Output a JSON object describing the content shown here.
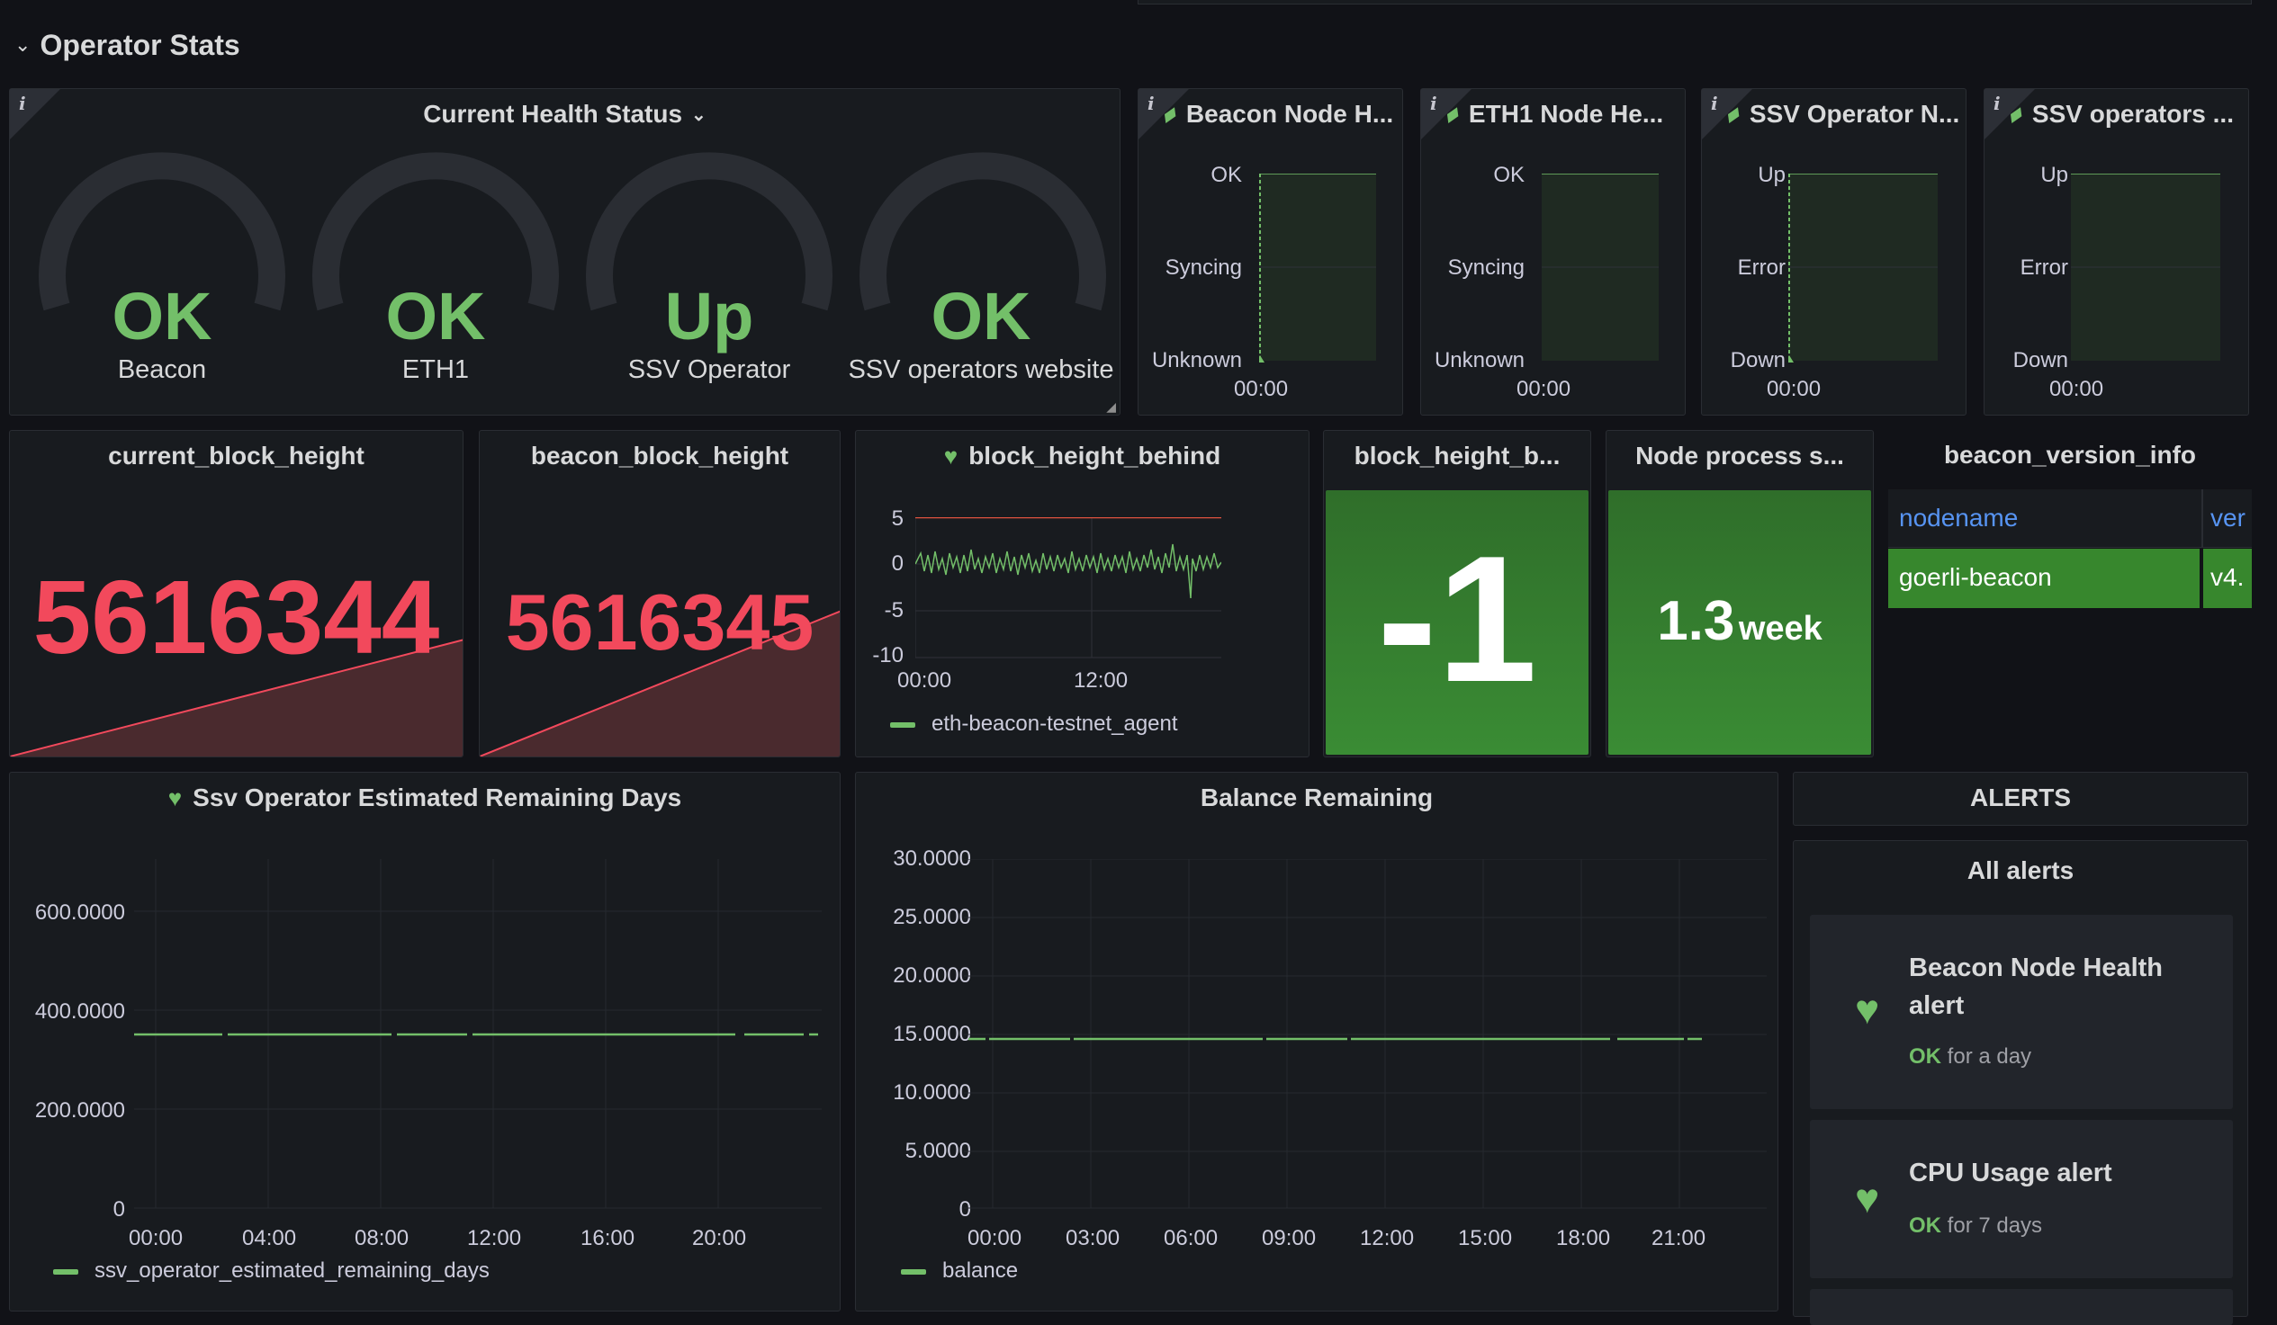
{
  "row": {
    "title": "Operator Stats"
  },
  "health": {
    "title": "Current Health Status",
    "gauges": [
      {
        "value": "OK",
        "label": "Beacon"
      },
      {
        "value": "OK",
        "label": "ETH1"
      },
      {
        "value": "Up",
        "label": "SSV Operator"
      },
      {
        "value": "OK",
        "label": "SSV operators website"
      }
    ]
  },
  "timelines": [
    {
      "title": "Beacon Node H...",
      "levels": [
        "OK",
        "Syncing",
        "Unknown"
      ],
      "xlabel": "00:00"
    },
    {
      "title": "ETH1 Node He...",
      "levels": [
        "OK",
        "Syncing",
        "Unknown"
      ],
      "xlabel": "00:00"
    },
    {
      "title": "SSV Operator N...",
      "levels": [
        "Up",
        "Error",
        "Down"
      ],
      "xlabel": "00:00"
    },
    {
      "title": "SSV operators ...",
      "levels": [
        "Up",
        "Error",
        "Down"
      ],
      "xlabel": "00:00"
    }
  ],
  "stats": {
    "current_block_height": {
      "title": "current_block_height",
      "value": "5616344"
    },
    "beacon_block_height": {
      "title": "beacon_block_height",
      "value": "5616345"
    },
    "block_height_b": {
      "title": "block_height_b...",
      "value": "-1"
    },
    "node_process": {
      "title": "Node process s...",
      "value": "1.3",
      "unit": "week"
    }
  },
  "behind": {
    "title": "block_height_behind",
    "yticks": [
      "5",
      "0",
      "-5",
      "-10"
    ],
    "xticks": [
      "00:00",
      "12:00"
    ],
    "legend": "eth-beacon-testnet_agent"
  },
  "version": {
    "title": "beacon_version_info",
    "headers": [
      "nodename",
      "ver"
    ],
    "row": [
      "goerli-beacon",
      "v4."
    ]
  },
  "ssv_days": {
    "title": "Ssv Operator Estimated Remaining Days",
    "yticks": [
      "600.0000",
      "400.0000",
      "200.0000",
      "0"
    ],
    "xticks": [
      "00:00",
      "04:00",
      "08:00",
      "12:00",
      "16:00",
      "20:00"
    ],
    "legend": "ssv_operator_estimated_remaining_days"
  },
  "balance": {
    "title": "Balance Remaining",
    "yticks": [
      "30.0000",
      "25.0000",
      "20.0000",
      "15.0000",
      "10.0000",
      "5.0000",
      "0"
    ],
    "xticks": [
      "00:00",
      "03:00",
      "06:00",
      "09:00",
      "12:00",
      "15:00",
      "18:00",
      "21:00"
    ],
    "legend": "balance"
  },
  "alerts": {
    "header": "ALERTS",
    "list_title": "All alerts",
    "items": [
      {
        "name": "Beacon Node Health alert",
        "state": "OK",
        "duration": "for a day"
      },
      {
        "name": "CPU Usage alert",
        "state": "OK",
        "duration": "for 7 days"
      }
    ]
  },
  "colors": {
    "ok": "#73bf69",
    "red": "#f2495c",
    "panel": "#181b1f",
    "bg": "#111217",
    "stat_green": "#37872d"
  }
}
